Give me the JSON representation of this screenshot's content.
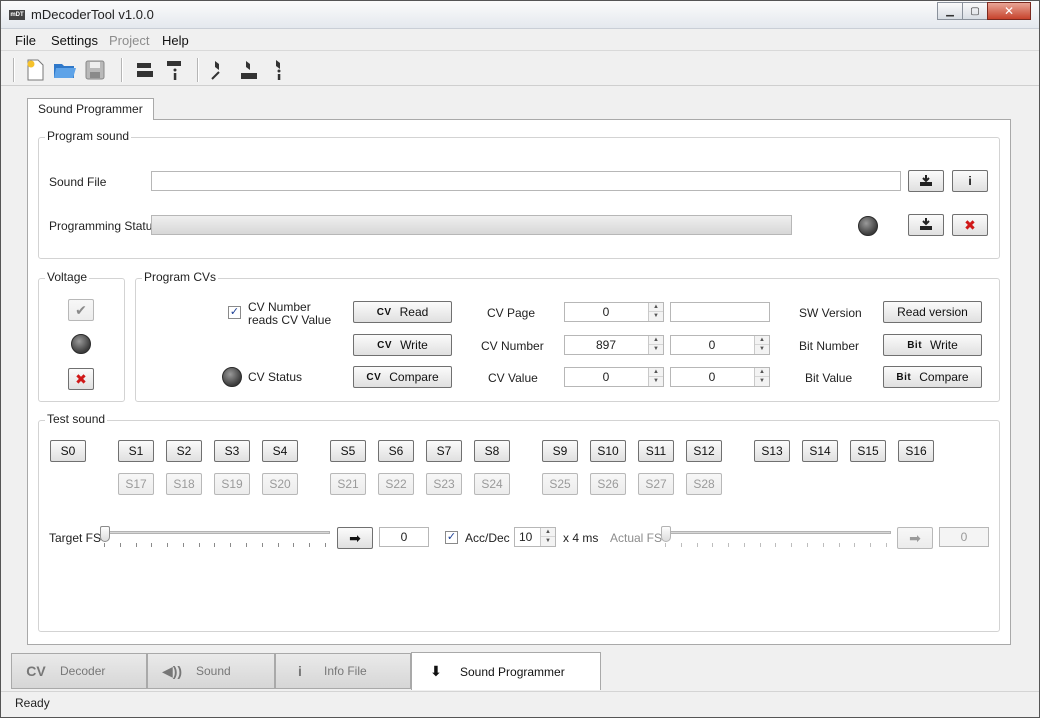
{
  "window": {
    "title": "mDecoderTool v1.0.0",
    "logo_text": "mDT"
  },
  "menu": {
    "file": "File",
    "settings": "Settings",
    "project": "Project",
    "help": "Help"
  },
  "inner_tab": {
    "label": "Sound Programmer"
  },
  "program_sound": {
    "title": "Program sound",
    "sound_file_label": "Sound File",
    "sound_file_value": "",
    "programming_status_label": "Programming Status",
    "progress_percent": 0
  },
  "voltage": {
    "title": "Voltage"
  },
  "program_cvs": {
    "title": "Program CVs",
    "cv_reads_label_1": "CV Number",
    "cv_reads_label_2": "reads CV Value",
    "cv_reads_checked": true,
    "cv_status_label": "CV Status",
    "btn_tag": "CV",
    "read_label": "Read",
    "write_label": "Write",
    "compare_label": "Compare",
    "cv_page_label": "CV Page",
    "cv_number_label": "CV Number",
    "cv_value_label": "CV Value",
    "cv_page_value": "0",
    "cv_page_text": "",
    "cv_number_value": "897",
    "cv_number_second": "0",
    "cv_value_value": "0",
    "cv_value_second": "0",
    "sw_version_label": "SW Version",
    "read_version_label": "Read version",
    "bit_number_label": "Bit Number",
    "bit_value_label": "Bit Value",
    "bit_tag": "Bit"
  },
  "test_sound": {
    "title": "Test sound",
    "target_fs_label": "Target FS",
    "target_fs_value": "0",
    "accdec_label": "Acc/Dec",
    "accdec_checked": true,
    "accdec_value": "10",
    "accdec_unit": "x 4 ms",
    "actual_fs_label": "Actual FS",
    "actual_fs_value": "0",
    "target_fs_level": 0,
    "actual_fs_level": 0,
    "row1": [
      "S0",
      "S1",
      "S2",
      "S3",
      "S4",
      "S5",
      "S6",
      "S7",
      "S8",
      "S9",
      "S10",
      "S11",
      "S12",
      "S13",
      "S14",
      "S15",
      "S16"
    ],
    "row2": [
      "S17",
      "S18",
      "S19",
      "S20",
      "S21",
      "S22",
      "S23",
      "S24",
      "S25",
      "S26",
      "S27",
      "S28"
    ]
  },
  "bottom_tabs": [
    {
      "icon": "CV",
      "label": "Decoder"
    },
    {
      "icon": "◀))",
      "label": "Sound"
    },
    {
      "icon": "i",
      "label": "Info File"
    },
    {
      "icon": "⬇",
      "label": "Sound Programmer"
    }
  ],
  "status": {
    "text": "Ready"
  },
  "colors": {
    "accent_red": "#d01818",
    "led_off": "#3c3c3c"
  }
}
